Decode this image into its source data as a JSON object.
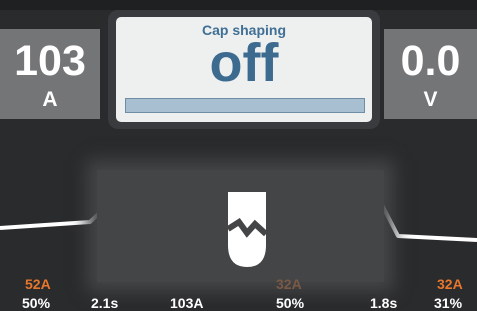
{
  "readout_left": {
    "value": "103",
    "unit": "A"
  },
  "readout_right": {
    "value": "0.0",
    "unit": "V"
  },
  "main": {
    "title": "Cap shaping",
    "value": "off"
  },
  "bottom": {
    "left_current": "52A",
    "mid_current": "32A",
    "right_current": "32A",
    "left_percent": "50%",
    "left_time": "2.1s",
    "center_current": "103A",
    "center_percent": "50%",
    "right_time": "1.8s",
    "right_percent": "31%"
  },
  "icons": {
    "nozzle": "electrode-nozzle-icon"
  },
  "colors": {
    "background": "#2a2b2d",
    "readout_bg": "#747577",
    "main_bg": "#eef0f0",
    "accent_blue": "#3d6b8f",
    "bar_blue": "#a8bfd1",
    "orange": "#e8762b"
  }
}
